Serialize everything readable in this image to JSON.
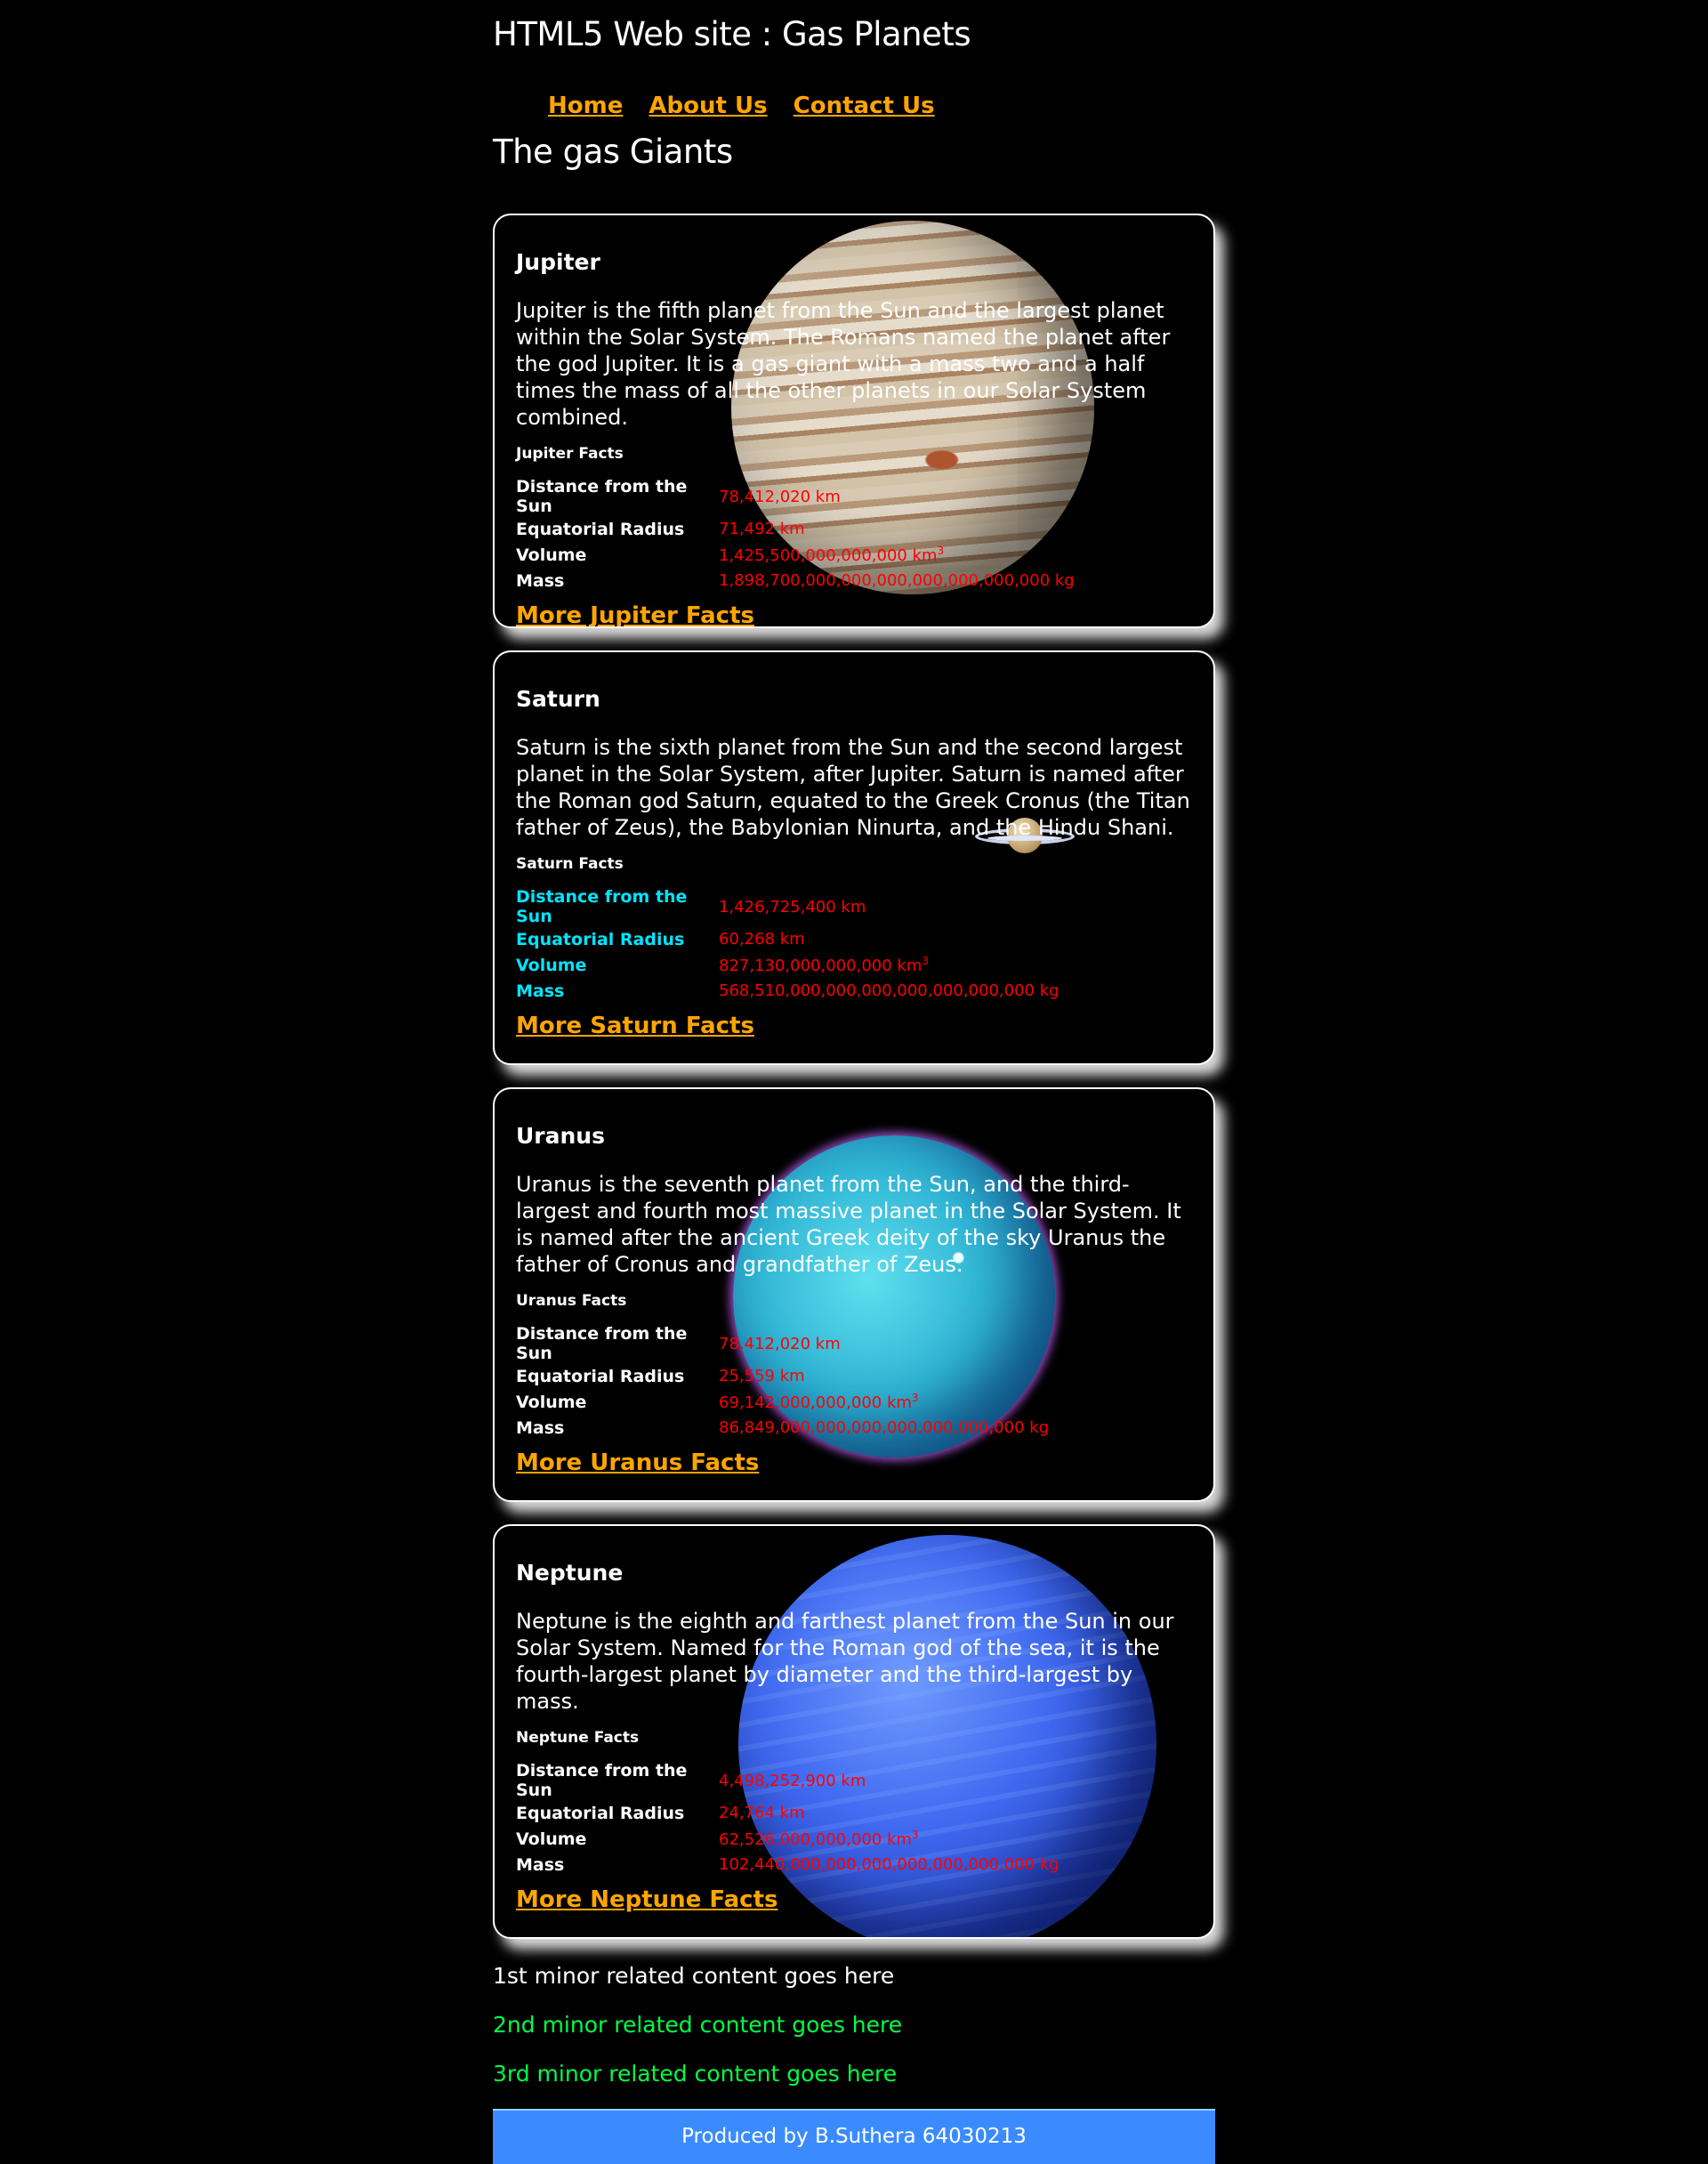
{
  "header": {
    "title": "HTML5 Web site : Gas Planets"
  },
  "nav": [
    {
      "label": "Home"
    },
    {
      "label": "About Us"
    },
    {
      "label": "Contact Us"
    }
  ],
  "main": {
    "title": "The gas Giants",
    "planets": [
      {
        "name": "Jupiter",
        "description": "Jupiter is the fifth planet from the Sun and the largest planet within the Solar System. The Romans named the planet after the god Jupiter. It is a gas giant with a mass two and a half times the mass of all the other planets in our Solar System combined.",
        "facts_title": "Jupiter Facts",
        "labels": [
          "Distance from the Sun",
          "Equatorial Radius",
          "Volume",
          "Mass"
        ],
        "values": [
          "78,412,020 km",
          "71,492 km",
          "1,425,500,000,000,000 km",
          "1,898,700,000,000,000,000,000,000,000 kg"
        ],
        "volume_sup": "3",
        "link": "More Jupiter Facts",
        "label_color": "#ffffff"
      },
      {
        "name": "Saturn",
        "description": "Saturn is the sixth planet from the Sun and the second largest planet in the Solar System, after Jupiter. Saturn is named after the Roman god Saturn, equated to the Greek Cronus (the Titan father of Zeus), the Babylonian Ninurta, and the Hindu Shani.",
        "facts_title": "Saturn Facts",
        "labels": [
          "Distance from the Sun",
          "Equatorial Radius",
          "Volume",
          "Mass"
        ],
        "values": [
          "1,426,725,400 km",
          "60,268 km",
          "827,130,000,000,000 km",
          "568,510,000,000,000,000,000,000,000 kg"
        ],
        "volume_sup": "3",
        "link": "More Saturn Facts",
        "label_color": "#00e5ff"
      },
      {
        "name": "Uranus",
        "description": "Uranus is the seventh planet from the Sun, and the third-largest and fourth most massive planet in the Solar System. It is named after the ancient Greek deity of the sky Uranus the father of Cronus and grandfather of Zeus.",
        "facts_title": "Uranus Facts",
        "labels": [
          "Distance from the Sun",
          "Equatorial Radius",
          "Volume",
          "Mass"
        ],
        "values": [
          "78,412,020 km",
          "25,559 km",
          "69,142,000,000,000 km",
          "86,849,000,000,000,000,000,000,000 kg"
        ],
        "volume_sup": "3",
        "link": "More Uranus Facts",
        "label_color": "#ffffff"
      },
      {
        "name": "Neptune",
        "description": "Neptune is the eighth and farthest planet from the Sun in our Solar System. Named for the Roman god of the sea, it is the fourth-largest planet by diameter and the third-largest by mass.",
        "facts_title": "Neptune Facts",
        "labels": [
          "Distance from the Sun",
          "Equatorial Radius",
          "Volume",
          "Mass"
        ],
        "values": [
          "4,498,252,900 km",
          "24,764 km",
          "62,526,000,000,000 km",
          "102,440,000,000,000,000,000,000,000 kg"
        ],
        "volume_sup": "3",
        "link": "More Neptune Facts",
        "label_color": "#ffffff"
      }
    ]
  },
  "aside": {
    "minor1": "1st minor related content goes here",
    "minor2": "2nd minor related content goes here",
    "minor3": "3rd minor related content goes here"
  },
  "footer": {
    "text": "Produced by B.Suthera 64030213"
  },
  "colors": {
    "link": "#ffa500",
    "fact_value": "#ff0000",
    "minor_green": "#00ff44",
    "footer_bg": "#3b8bff"
  },
  "icons": [
    "jupiter-image",
    "saturn-image",
    "uranus-image",
    "neptune-image"
  ]
}
